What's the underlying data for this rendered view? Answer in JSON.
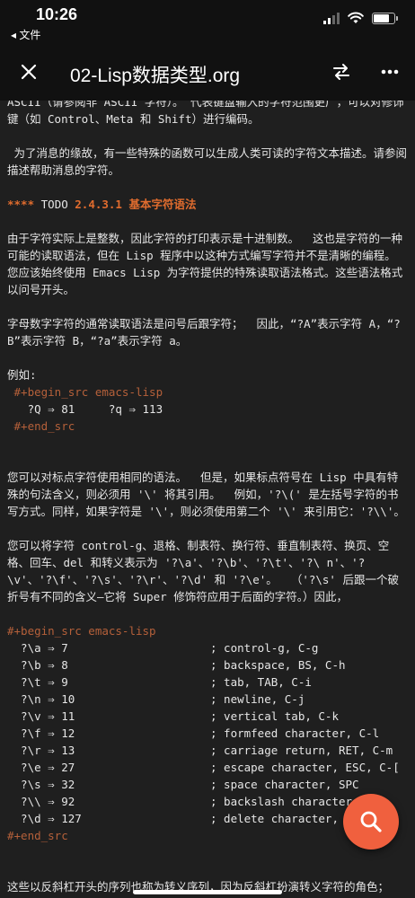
{
  "status": {
    "time": "10:26",
    "back_app": "◂ 文件"
  },
  "header": {
    "title": "02-Lisp数据类型.org"
  },
  "content": {
    "p0": "ASCII（请参阅非 ASCII 字符）。 代表键盘输入的字符范围更广，可以对修饰键（如 Control、Meta 和 Shift）进行编码。",
    "p1": " 为了消息的缘故，有一些特殊的函数可以生成人类可读的字符文本描述。请参阅描述帮助消息的字符。",
    "heading": {
      "stars": "****",
      "keyword": "TODO",
      "text": "2.4.3.1 基本字符语法"
    },
    "p2": "由于字符实际上是整数，因此字符的打印表示是十进制数。  这也是字符的一种可能的读取语法，但在 Lisp 程序中以这种方式编写字符并不是清晰的编程。  您应该始终使用 Emacs Lisp 为字符提供的特殊读取语法格式。这些语法格式以问号开头。",
    "p3": "字母数字字符的通常读取语法是问号后跟字符；  因此，“?A”表示字符 A，“?B”表示字符 B，“?a”表示字符 a。",
    "p4": "例如:",
    "src1": {
      "begin": " #+begin_src emacs-lisp",
      "line": "   ?Q ⇒ 81     ?q ⇒ 113",
      "end": " #+end_src"
    },
    "p5": "您可以对标点字符使用相同的语法。  但是，如果标点符号在 Lisp 中具有特殊的句法含义，则必须用 '\\' 将其引用。  例如，'?\\(' 是左括号字符的书写方式。同样，如果字符是 '\\'，则必须使用第二个 '\\' 来引用它：'?\\\\'。",
    "p6": "您可以将字符 control-g、退格、制表符、换行符、垂直制表符、换页、空格、回车、del 和转义表示为 '?\\a'、'?\\b'、'?\\t'、'?\\ n'、'?\\v'、'?\\f'、'?\\s'、'?\\r'、'?\\d' 和 '?\\e'。  （'?\\s' 后跟一个破折号有不同的含义—它将 Super 修饰符应用于后面的字符。）因此，",
    "src2": {
      "begin": "#+begin_src emacs-lisp",
      "lines": [
        {
          "code": "  ?\\a ⇒ 7",
          "comment": "; control-g, C-g"
        },
        {
          "code": "  ?\\b ⇒ 8",
          "comment": "; backspace, BS, C-h"
        },
        {
          "code": "  ?\\t ⇒ 9",
          "comment": "; tab, TAB, C-i"
        },
        {
          "code": "  ?\\n ⇒ 10",
          "comment": "; newline, C-j"
        },
        {
          "code": "  ?\\v ⇒ 11",
          "comment": "; vertical tab, C-k"
        },
        {
          "code": "  ?\\f ⇒ 12",
          "comment": "; formfeed character, C-l"
        },
        {
          "code": "  ?\\r ⇒ 13",
          "comment": "; carriage return, RET, C-m"
        },
        {
          "code": "  ?\\e ⇒ 27",
          "comment": "; escape character, ESC, C-["
        },
        {
          "code": "  ?\\s ⇒ 32",
          "comment": "; space character, SPC"
        },
        {
          "code": "  ?\\\\ ⇒ 92",
          "comment": "; backslash character, \\"
        },
        {
          "code": "  ?\\d ⇒ 127",
          "comment": "; delete character, DEL"
        }
      ],
      "end": "#+end_src"
    },
    "p7": "这些以反斜杠开头的序列也称为转义序列，因为反斜杠扮演转义字符的角色；  这与字符 ESC 无关。 '\\s' 用于字符常量；  在字符串常量中，只写空格。"
  },
  "colors": {
    "background": "#1f1f1f",
    "accent": "#e06c2e",
    "fab": "#f0603e"
  },
  "icons": {
    "close": "close-icon",
    "sync": "sync-icon",
    "more": "more-icon",
    "search": "search-icon"
  }
}
